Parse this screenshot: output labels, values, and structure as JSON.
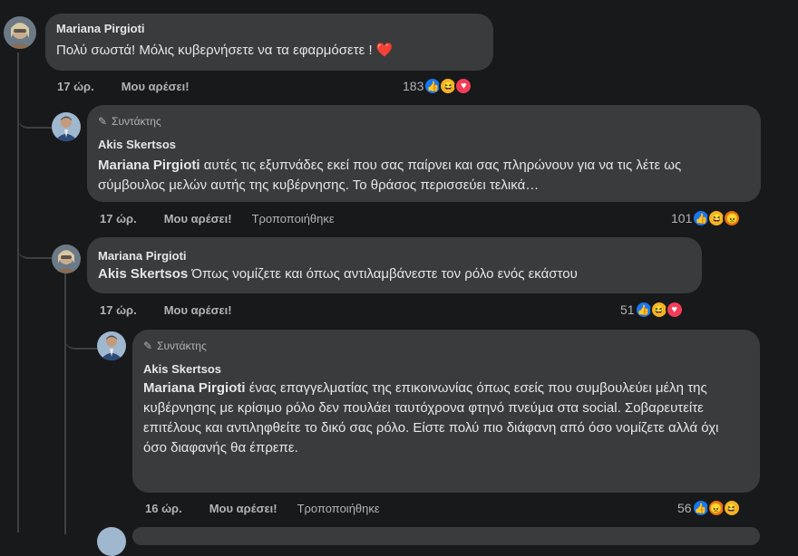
{
  "comments": [
    {
      "author": "Mariana Pirgioti",
      "text": "Πολύ σωστά! Μόλις κυβερνήσετε να τα εφαρμόσετε ! ❤️",
      "time": "17 ώρ.",
      "like_label": "Μου αρέσει!",
      "reaction_count": "183",
      "reactions": [
        "like-icon",
        "haha-icon",
        "love-icon"
      ]
    },
    {
      "badge": "Συντάκτης",
      "author": "Akis Skertsos",
      "mention": "Mariana Pirgioti",
      "text": " αυτές τις εξυπνάδες εκεί που σας παίρνει και σας πληρώνουν για να τις λέτε ως σύμβουλος μελών αυτής της κυβέρνησης. Το θράσος περισσεύει τελικά…",
      "time": "17 ώρ.",
      "like_label": "Μου αρέσει!",
      "edited_label": "Τροποποιήθηκε",
      "reaction_count": "101",
      "reactions": [
        "like-icon",
        "haha-icon",
        "angry-icon"
      ]
    },
    {
      "author": "Mariana Pirgioti",
      "mention": "Akis Skertsos",
      "text": " Όπως νομίζετε και όπως αντιλαμβάνεστε τον ρόλο ενός εκάστου",
      "time": "17 ώρ.",
      "like_label": "Μου αρέσει!",
      "reaction_count": "51",
      "reactions": [
        "like-icon",
        "haha-icon",
        "love-icon"
      ]
    },
    {
      "badge": "Συντάκτης",
      "author": "Akis Skertsos",
      "mention": "Mariana Pirgioti",
      "text": " ένας επαγγελματίας της επικοινωνίας όπως εσείς που συμβουλεύει μέλη της κυβέρνησης με κρίσιμο ρόλο δεν πουλάει ταυτόχρονα φτηνό πνεύμα στα social. Σοβαρευτείτε επιτέλους και αντιληφθείτε το δικό σας ρόλο. Είστε πολύ πιο διάφανη από όσο νομίζετε αλλά όχι όσο διαφανής θα έπρεπε.",
      "time": "16 ώρ.",
      "like_label": "Μου αρέσει!",
      "edited_label": "Τροποποιήθηκε",
      "reaction_count": "56",
      "reactions": [
        "like-icon",
        "angry-icon",
        "haha-icon"
      ]
    }
  ],
  "colors": {
    "background": "#18191a",
    "bubble": "#3a3b3c",
    "text": "#e4e6eb",
    "secondary": "#b0b3b8",
    "like": "#1877f2",
    "haha": "#f7b125",
    "love": "#f33e58",
    "angry": "#e9710f"
  }
}
